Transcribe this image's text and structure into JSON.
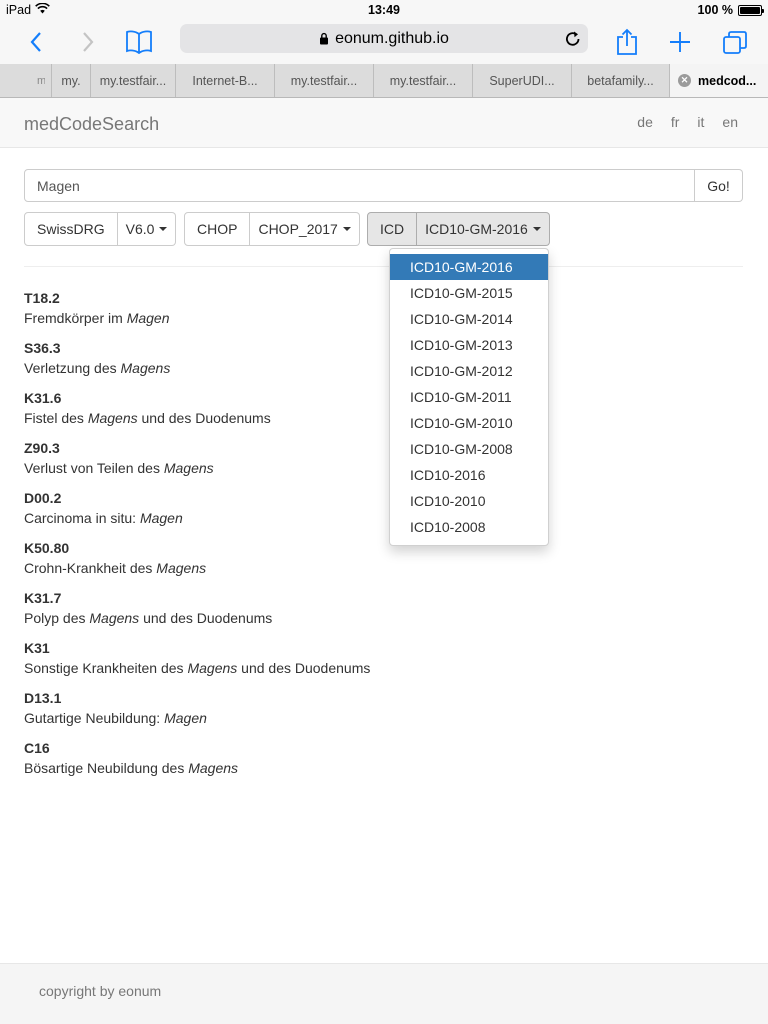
{
  "statusbar": {
    "device": "iPad",
    "time": "13:49",
    "battery": "100 %"
  },
  "browser": {
    "url": "eonum.github.io",
    "tabs": [
      "my.",
      "my.",
      "my.testfair...",
      "Internet-B...",
      "my.testfair...",
      "my.testfair...",
      "SuperUDI...",
      "betafamily...",
      "medcod..."
    ]
  },
  "navbar": {
    "brand": "medCodeSearch",
    "langs": [
      "de",
      "fr",
      "it",
      "en"
    ]
  },
  "search": {
    "value": "Magen",
    "go_label": "Go!"
  },
  "filters": {
    "swissdrg": {
      "label": "SwissDRG",
      "version": "V6.0"
    },
    "chop": {
      "label": "CHOP",
      "version": "CHOP_2017"
    },
    "icd": {
      "label": "ICD",
      "version": "ICD10-GM-2016"
    }
  },
  "dropdown": {
    "items": [
      "ICD10-GM-2016",
      "ICD10-GM-2015",
      "ICD10-GM-2014",
      "ICD10-GM-2013",
      "ICD10-GM-2012",
      "ICD10-GM-2011",
      "ICD10-GM-2010",
      "ICD10-GM-2008",
      "ICD10-2016",
      "ICD10-2010",
      "ICD10-2008"
    ],
    "selected": "ICD10-GM-2016"
  },
  "results": [
    {
      "code": "T18.2",
      "pre": "Fremdkörper im ",
      "em": "Magen",
      "post": ""
    },
    {
      "code": "S36.3",
      "pre": "Verletzung des ",
      "em": "Magens",
      "post": ""
    },
    {
      "code": "K31.6",
      "pre": "Fistel des ",
      "em": "Magens",
      "post": " und des Duodenums"
    },
    {
      "code": "Z90.3",
      "pre": "Verlust von Teilen des ",
      "em": "Magens",
      "post": ""
    },
    {
      "code": "D00.2",
      "pre": "Carcinoma in situ: ",
      "em": "Magen",
      "post": ""
    },
    {
      "code": "K50.80",
      "pre": "Crohn-Krankheit des ",
      "em": "Magens",
      "post": ""
    },
    {
      "code": "K31.7",
      "pre": "Polyp des ",
      "em": "Magens",
      "post": " und des Duodenums"
    },
    {
      "code": "K31",
      "pre": "Sonstige Krankheiten des ",
      "em": "Magens",
      "post": " und des Duodenums"
    },
    {
      "code": "D13.1",
      "pre": "Gutartige Neubildung: ",
      "em": "Magen",
      "post": ""
    },
    {
      "code": "C16",
      "pre": "Bösartige Neubildung des ",
      "em": "Magens",
      "post": ""
    }
  ],
  "footer": {
    "text": "copyright by eonum"
  },
  "colors": {
    "ios_blue": "#147efb",
    "active_item": "#337ab7"
  }
}
